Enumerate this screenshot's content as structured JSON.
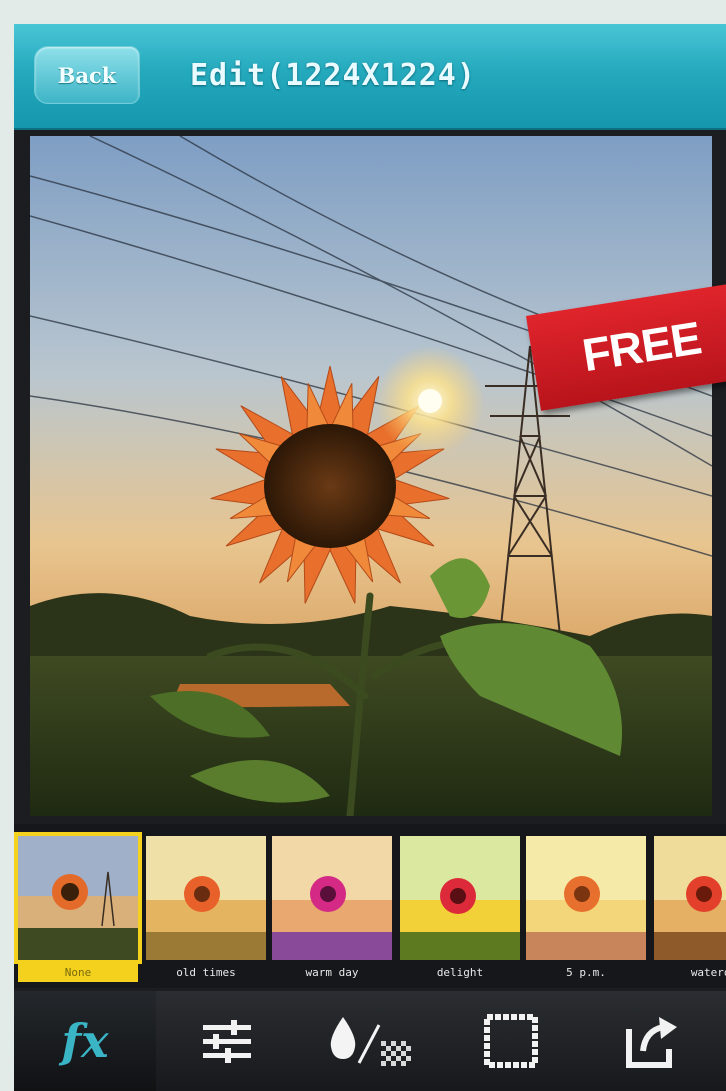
{
  "header": {
    "back_label": "Back",
    "title": "Edit(1224X1224)"
  },
  "banner": {
    "text": "FREE"
  },
  "filters": [
    {
      "label": "None",
      "selected": true
    },
    {
      "label": "old times",
      "selected": false
    },
    {
      "label": "warm day",
      "selected": false
    },
    {
      "label": "delight",
      "selected": false
    },
    {
      "label": "5 p.m.",
      "selected": false
    },
    {
      "label": "wateroo",
      "selected": false
    }
  ],
  "toolbar": {
    "fx_label": "fx",
    "items": [
      "fx",
      "adjust-sliders-icon",
      "drop-texture-icon",
      "frame-border-icon",
      "share-export-icon"
    ]
  },
  "colors": {
    "header_accent": "#25a9bd",
    "selected_filter": "#f3d11c",
    "banner_red": "#d01c24",
    "fx_accent": "#3ab5c6"
  }
}
